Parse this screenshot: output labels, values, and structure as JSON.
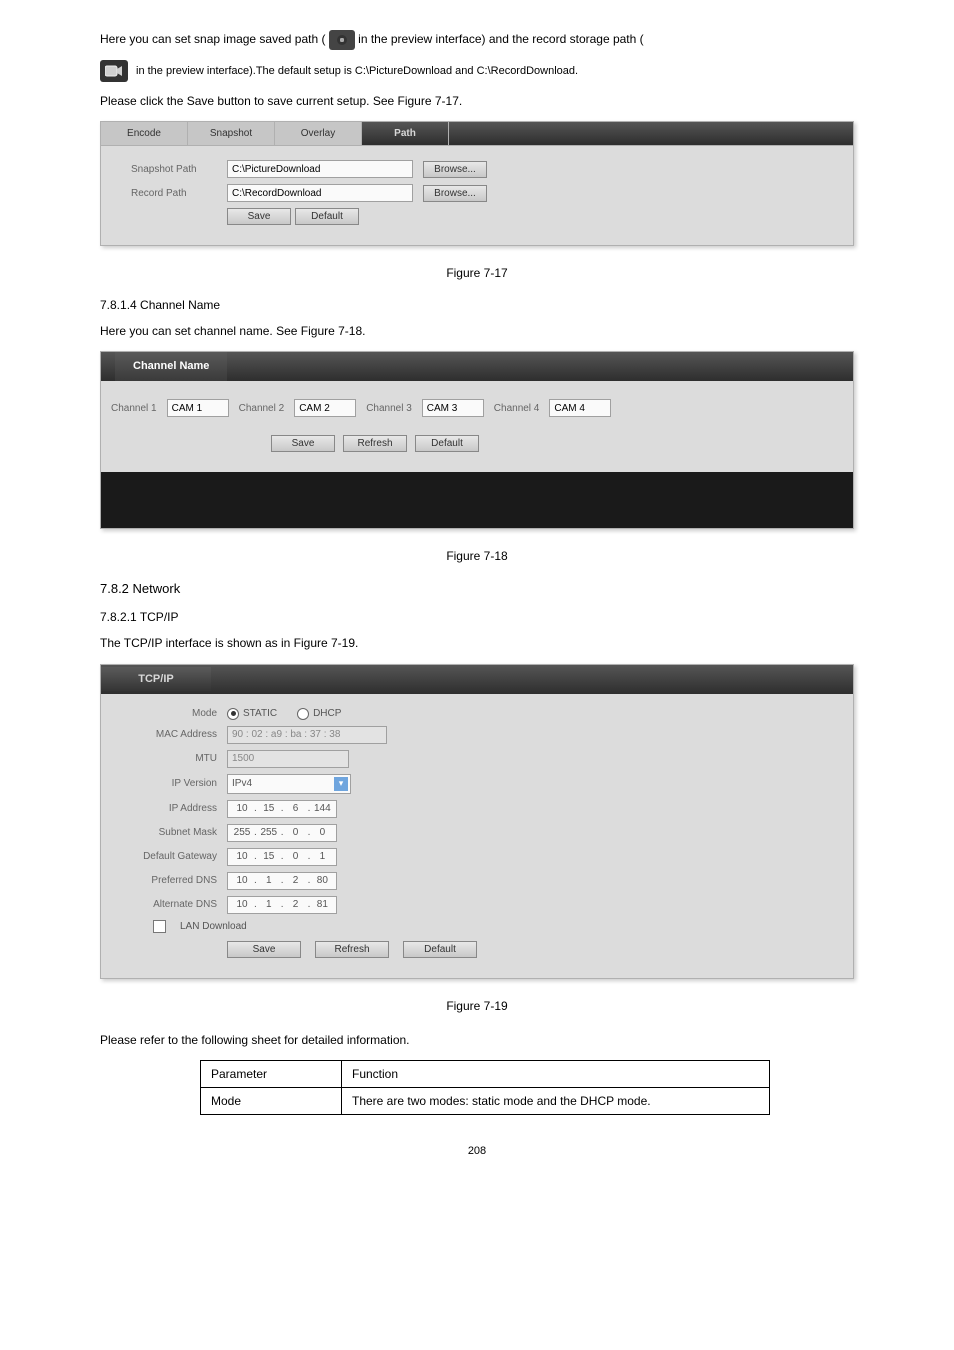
{
  "path_section": {
    "intro_prefix": "Here you can set snap image saved path (",
    "intro_mid": " in the preview interface) and the record storage path (",
    "intro_suffix": " in the preview interface).The default setup is C:\\PictureDownload and C:\\RecordDownload.",
    "figure": "Please click the Save button to save current setup. See Figure 7-17.",
    "tabs": {
      "encode": "Encode",
      "snapshot": "Snapshot",
      "overlay": "Overlay",
      "path": "Path"
    },
    "snapshot_label": "Snapshot Path",
    "record_label": "Record Path",
    "snapshot_value": "C:\\PictureDownload",
    "record_value": "C:\\RecordDownload",
    "browse": "Browse...",
    "save": "Save",
    "default": "Default",
    "caption": "Figure 7-17"
  },
  "channel_section": {
    "title": "7.8.1.4 Channel Name",
    "intro": "Here you can set channel name. See Figure 7-18.",
    "tab": "Channel Name",
    "labels": {
      "c1": "Channel 1",
      "c2": "Channel 2",
      "c3": "Channel 3",
      "c4": "Channel 4"
    },
    "values": {
      "c1": "CAM 1",
      "c2": "CAM 2",
      "c3": "CAM 3",
      "c4": "CAM 4"
    },
    "save": "Save",
    "refresh": "Refresh",
    "default": "Default",
    "caption": "Figure 7-18"
  },
  "network_section": {
    "title": "7.8.2 Network",
    "subtitle": "7.8.2.1 TCP/IP",
    "intro": "The TCP/IP interface is shown as in Figure 7-19.",
    "tab": "TCP/IP",
    "labels": {
      "mode": "Mode",
      "mac": "MAC Address",
      "mtu": "MTU",
      "ipver": "IP Version",
      "ipaddr": "IP Address",
      "subnet": "Subnet Mask",
      "gateway": "Default Gateway",
      "pdns": "Preferred DNS",
      "adns": "Alternate DNS",
      "lan": "LAN Download"
    },
    "mode_static": "STATIC",
    "mode_dhcp": "DHCP",
    "mac_value": "90 : 02 : a9 : ba : 37 : 38",
    "mtu_value": "1500",
    "ipver_value": "IPv4",
    "ip": {
      "a": "10",
      "b": "15",
      "c": "6",
      "d": "144"
    },
    "subnet": {
      "a": "255",
      "b": "255",
      "c": "0",
      "d": "0"
    },
    "gateway": {
      "a": "10",
      "b": "15",
      "c": "0",
      "d": "1"
    },
    "pdns": {
      "a": "10",
      "b": "1",
      "c": "2",
      "d": "80"
    },
    "adns": {
      "a": "10",
      "b": "1",
      "c": "2",
      "d": "81"
    },
    "save": "Save",
    "refresh": "Refresh",
    "default": "Default",
    "caption": "Figure 7-19",
    "table": {
      "h1": "Parameter",
      "h2": "Function",
      "r1p": "Mode",
      "r1f": "There are two modes: static mode and the DHCP mode."
    }
  },
  "page_number": "208"
}
